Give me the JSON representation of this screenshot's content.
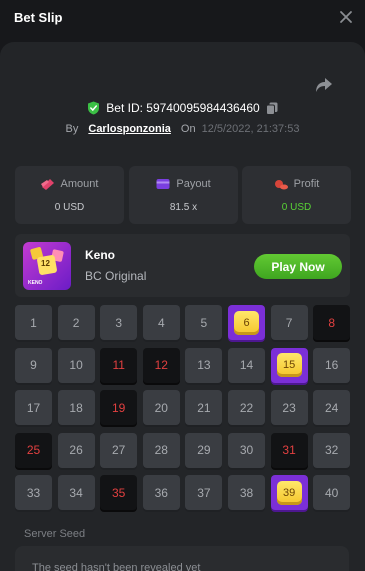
{
  "header": {
    "title": "Bet Slip"
  },
  "bet": {
    "id_label": "Bet ID: 59740095984436460",
    "by_label": "By",
    "username": "Carlosponzonia",
    "on_label": "On",
    "datetime": "12/5/2022, 21:37:53"
  },
  "stats": {
    "amount": {
      "label": "Amount",
      "value": "0 USD"
    },
    "payout": {
      "label": "Payout",
      "value": "81.5 x"
    },
    "profit": {
      "label": "Profit",
      "value": "0 USD"
    }
  },
  "game": {
    "name": "Keno",
    "subtitle": "BC Original",
    "thumb_number": "12",
    "thumb_caption": "KENO",
    "play_label": "Play Now"
  },
  "grid": {
    "columns": 8,
    "cells": [
      {
        "n": "1",
        "state": "normal"
      },
      {
        "n": "2",
        "state": "normal"
      },
      {
        "n": "3",
        "state": "normal"
      },
      {
        "n": "4",
        "state": "normal"
      },
      {
        "n": "5",
        "state": "normal"
      },
      {
        "n": "6",
        "state": "hit"
      },
      {
        "n": "7",
        "state": "normal"
      },
      {
        "n": "8",
        "state": "miss"
      },
      {
        "n": "9",
        "state": "normal"
      },
      {
        "n": "10",
        "state": "normal"
      },
      {
        "n": "11",
        "state": "miss"
      },
      {
        "n": "12",
        "state": "miss"
      },
      {
        "n": "13",
        "state": "normal"
      },
      {
        "n": "14",
        "state": "normal"
      },
      {
        "n": "15",
        "state": "hit"
      },
      {
        "n": "16",
        "state": "normal"
      },
      {
        "n": "17",
        "state": "normal"
      },
      {
        "n": "18",
        "state": "normal"
      },
      {
        "n": "19",
        "state": "miss"
      },
      {
        "n": "20",
        "state": "normal"
      },
      {
        "n": "21",
        "state": "normal"
      },
      {
        "n": "22",
        "state": "normal"
      },
      {
        "n": "23",
        "state": "normal"
      },
      {
        "n": "24",
        "state": "normal"
      },
      {
        "n": "25",
        "state": "miss"
      },
      {
        "n": "26",
        "state": "normal"
      },
      {
        "n": "27",
        "state": "normal"
      },
      {
        "n": "28",
        "state": "normal"
      },
      {
        "n": "29",
        "state": "normal"
      },
      {
        "n": "30",
        "state": "normal"
      },
      {
        "n": "31",
        "state": "miss"
      },
      {
        "n": "32",
        "state": "normal"
      },
      {
        "n": "33",
        "state": "normal"
      },
      {
        "n": "34",
        "state": "normal"
      },
      {
        "n": "35",
        "state": "miss"
      },
      {
        "n": "36",
        "state": "normal"
      },
      {
        "n": "37",
        "state": "normal"
      },
      {
        "n": "38",
        "state": "normal"
      },
      {
        "n": "39",
        "state": "hit"
      },
      {
        "n": "40",
        "state": "normal"
      }
    ]
  },
  "seed": {
    "label": "Server Seed",
    "text": "The seed hasn't been revealed yet"
  },
  "colors": {
    "accent_green": "#58d235",
    "hit_purple": "#7b2fd7",
    "miss_red": "#e24040",
    "gem_yellow": "#f4c52a"
  },
  "icons": [
    "close-icon",
    "share-icon",
    "shield-check-icon",
    "copy-icon",
    "money-icon",
    "wallet-icon",
    "coins-icon"
  ]
}
